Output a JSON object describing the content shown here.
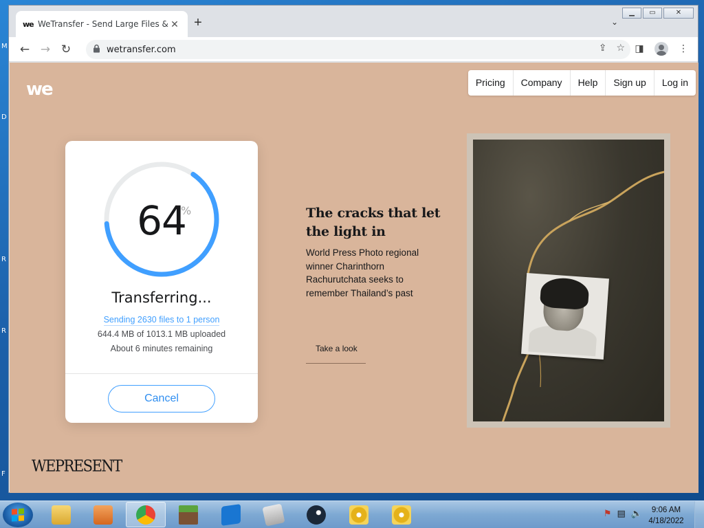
{
  "desktop": {
    "side_letters": [
      "M",
      "D",
      "R",
      "R",
      "F"
    ]
  },
  "browser": {
    "tab": {
      "favicon": "we",
      "title": "WeTransfer - Send Large Files &",
      "close": "✕"
    },
    "new_tab": "+",
    "tab_menu": "⌄",
    "window_controls": {
      "minimize": "▁",
      "maximize": "▭",
      "close": "✕"
    },
    "nav": {
      "back": "←",
      "forward": "→",
      "reload": "↻"
    },
    "lock": "🔒",
    "url": "wetransfer.com",
    "omnibox_icons": {
      "share": "⇪",
      "bookmark": "☆"
    },
    "toolbar_icons": {
      "side_panel": "◨",
      "menu": "⋮"
    }
  },
  "page": {
    "logo": "we",
    "nav": [
      "Pricing",
      "Company",
      "Help",
      "Sign up",
      "Log in"
    ],
    "transfer": {
      "percent": "64",
      "percent_sign": "%",
      "progress_fraction": 0.64,
      "status": "Transferring...",
      "sending": "Sending 2630 files to 1 person",
      "uploaded": "644.4 MB of 1013.1 MB uploaded",
      "remaining": "About 6 minutes remaining",
      "cancel_label": "Cancel",
      "ring_track_color": "#e9ebec",
      "ring_fill_color": "#409fff"
    },
    "article": {
      "headline": "The cracks that let the light in",
      "blurb": "World Press Photo regional winner Charinthorn Rachurutchata seeks to remember Thailand’s past",
      "cta": "Take a look"
    },
    "footer_brand": "WEPRESENT",
    "background_color": "#d9b59b"
  },
  "taskbar": {
    "apps": [
      "file-explorer",
      "media-player",
      "chrome",
      "minecraft",
      "app-blue",
      "app-grey",
      "steam",
      "disc-app-1",
      "disc-app-2"
    ],
    "active_app": "chrome",
    "tray_icons": [
      "network-error",
      "network",
      "volume"
    ],
    "time": "9:06 AM",
    "date": "4/18/2022"
  }
}
